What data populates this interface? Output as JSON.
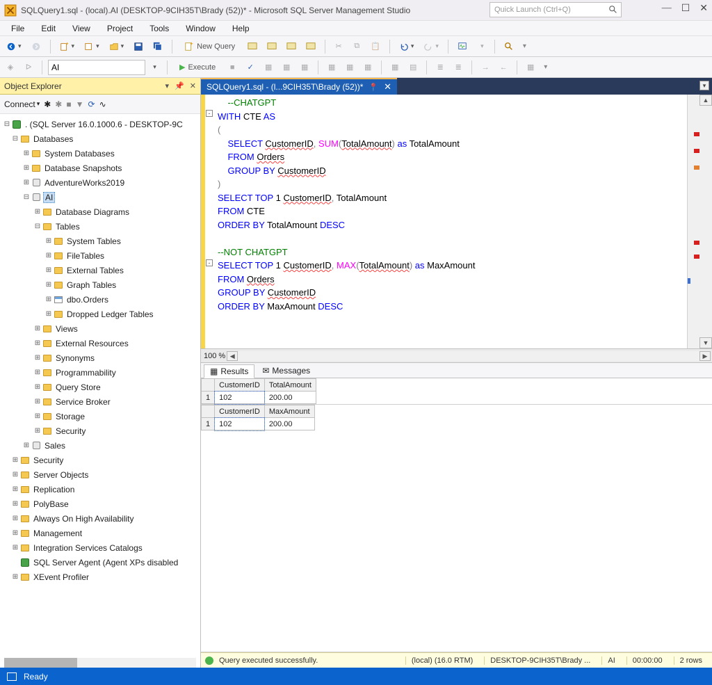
{
  "title_bar": {
    "text": "SQLQuery1.sql - (local).AI (DESKTOP-9CIH35T\\Brady (52))* - Microsoft SQL Server Management Studio",
    "quick_launch_placeholder": "Quick Launch (Ctrl+Q)"
  },
  "menu": {
    "items": [
      "File",
      "Edit",
      "View",
      "Project",
      "Tools",
      "Window",
      "Help"
    ]
  },
  "toolbar1": {
    "new_query": "New Query",
    "db_selector": "AI"
  },
  "toolbar2": {
    "db_selector": "AI",
    "execute": "Execute"
  },
  "object_explorer": {
    "title": "Object Explorer",
    "connect": "Connect",
    "nodes": [
      {
        "depth": 0,
        "tw": "⊟",
        "icon": "srv",
        "label": ". (SQL Server 16.0.1000.6 - DESKTOP-9C"
      },
      {
        "depth": 1,
        "tw": "⊟",
        "icon": "folder",
        "label": "Databases"
      },
      {
        "depth": 2,
        "tw": "⊞",
        "icon": "folder",
        "label": "System Databases"
      },
      {
        "depth": 2,
        "tw": "⊞",
        "icon": "folder",
        "label": "Database Snapshots"
      },
      {
        "depth": 2,
        "tw": "⊞",
        "icon": "db",
        "label": "AdventureWorks2019"
      },
      {
        "depth": 2,
        "tw": "⊟",
        "icon": "db",
        "label": "AI",
        "selected": true
      },
      {
        "depth": 3,
        "tw": "⊞",
        "icon": "folder",
        "label": "Database Diagrams"
      },
      {
        "depth": 3,
        "tw": "⊟",
        "icon": "folder",
        "label": "Tables"
      },
      {
        "depth": 4,
        "tw": "⊞",
        "icon": "folder",
        "label": "System Tables"
      },
      {
        "depth": 4,
        "tw": "⊞",
        "icon": "folder",
        "label": "FileTables"
      },
      {
        "depth": 4,
        "tw": "⊞",
        "icon": "folder",
        "label": "External Tables"
      },
      {
        "depth": 4,
        "tw": "⊞",
        "icon": "folder",
        "label": "Graph Tables"
      },
      {
        "depth": 4,
        "tw": "⊞",
        "icon": "tbl",
        "label": "dbo.Orders"
      },
      {
        "depth": 4,
        "tw": "⊞",
        "icon": "folder",
        "label": "Dropped Ledger Tables"
      },
      {
        "depth": 3,
        "tw": "⊞",
        "icon": "folder",
        "label": "Views"
      },
      {
        "depth": 3,
        "tw": "⊞",
        "icon": "folder",
        "label": "External Resources"
      },
      {
        "depth": 3,
        "tw": "⊞",
        "icon": "folder",
        "label": "Synonyms"
      },
      {
        "depth": 3,
        "tw": "⊞",
        "icon": "folder",
        "label": "Programmability"
      },
      {
        "depth": 3,
        "tw": "⊞",
        "icon": "folder",
        "label": "Query Store"
      },
      {
        "depth": 3,
        "tw": "⊞",
        "icon": "folder",
        "label": "Service Broker"
      },
      {
        "depth": 3,
        "tw": "⊞",
        "icon": "folder",
        "label": "Storage"
      },
      {
        "depth": 3,
        "tw": "⊞",
        "icon": "folder",
        "label": "Security"
      },
      {
        "depth": 2,
        "tw": "⊞",
        "icon": "db",
        "label": "Sales"
      },
      {
        "depth": 1,
        "tw": "⊞",
        "icon": "folder",
        "label": "Security"
      },
      {
        "depth": 1,
        "tw": "⊞",
        "icon": "folder",
        "label": "Server Objects"
      },
      {
        "depth": 1,
        "tw": "⊞",
        "icon": "folder",
        "label": "Replication"
      },
      {
        "depth": 1,
        "tw": "⊞",
        "icon": "folder",
        "label": "PolyBase"
      },
      {
        "depth": 1,
        "tw": "⊞",
        "icon": "folder",
        "label": "Always On High Availability"
      },
      {
        "depth": 1,
        "tw": "⊞",
        "icon": "folder",
        "label": "Management"
      },
      {
        "depth": 1,
        "tw": "⊞",
        "icon": "folder",
        "label": "Integration Services Catalogs"
      },
      {
        "depth": 1,
        "tw": "",
        "icon": "srv",
        "label": "SQL Server Agent (Agent XPs disabled"
      },
      {
        "depth": 1,
        "tw": "⊞",
        "icon": "folder",
        "label": "XEvent Profiler"
      }
    ]
  },
  "editor": {
    "tab_label": "SQLQuery1.sql - (l...9CIH35T\\Brady (52))*",
    "zoom": "100 %",
    "code_lines": [
      [
        {
          "c": "gr",
          "t": "    --CHATGPT"
        }
      ],
      [
        {
          "c": "b",
          "t": "WITH"
        },
        {
          "c": "k",
          "t": " CTE "
        },
        {
          "c": "b",
          "t": "AS"
        }
      ],
      [
        {
          "c": "g",
          "t": "("
        }
      ],
      [
        {
          "c": "k",
          "t": "    "
        },
        {
          "c": "b",
          "t": "SELECT"
        },
        {
          "c": "k",
          "t": " "
        },
        {
          "c": "k",
          "t": "CustomerID",
          "u": 1
        },
        {
          "c": "g",
          "t": ", "
        },
        {
          "c": "m",
          "t": "SUM"
        },
        {
          "c": "g",
          "t": "("
        },
        {
          "c": "k",
          "t": "TotalAmount",
          "u": 1
        },
        {
          "c": "g",
          "t": ")"
        },
        {
          "c": "b",
          "t": " as "
        },
        {
          "c": "k",
          "t": "TotalAmount"
        }
      ],
      [
        {
          "c": "k",
          "t": "    "
        },
        {
          "c": "b",
          "t": "FROM"
        },
        {
          "c": "k",
          "t": " "
        },
        {
          "c": "k",
          "t": "Orders",
          "u": 1
        }
      ],
      [
        {
          "c": "k",
          "t": "    "
        },
        {
          "c": "b",
          "t": "GROUP BY"
        },
        {
          "c": "k",
          "t": " "
        },
        {
          "c": "k",
          "t": "CustomerID",
          "u": 1
        }
      ],
      [
        {
          "c": "g",
          "t": ")"
        }
      ],
      [
        {
          "c": "b",
          "t": "SELECT TOP"
        },
        {
          "c": "k",
          "t": " 1 "
        },
        {
          "c": "k",
          "t": "CustomerID",
          "u": 1
        },
        {
          "c": "g",
          "t": ", "
        },
        {
          "c": "k",
          "t": "TotalAmount"
        }
      ],
      [
        {
          "c": "b",
          "t": "FROM"
        },
        {
          "c": "k",
          "t": " CTE"
        }
      ],
      [
        {
          "c": "b",
          "t": "ORDER BY"
        },
        {
          "c": "k",
          "t": " TotalAmount "
        },
        {
          "c": "b",
          "t": "DESC"
        }
      ],
      [
        {
          "c": "k",
          "t": ""
        }
      ],
      [
        {
          "c": "gr",
          "t": "--NOT CHATGPT"
        }
      ],
      [
        {
          "c": "b",
          "t": "SELECT TOP"
        },
        {
          "c": "k",
          "t": " 1 "
        },
        {
          "c": "k",
          "t": "CustomerID",
          "u": 1
        },
        {
          "c": "g",
          "t": ", "
        },
        {
          "c": "m",
          "t": "MAX"
        },
        {
          "c": "g",
          "t": "("
        },
        {
          "c": "k",
          "t": "TotalAmount",
          "u": 1
        },
        {
          "c": "g",
          "t": ")"
        },
        {
          "c": "b",
          "t": " as "
        },
        {
          "c": "k",
          "t": "MaxAmount"
        }
      ],
      [
        {
          "c": "b",
          "t": "FROM"
        },
        {
          "c": "k",
          "t": " "
        },
        {
          "c": "k",
          "t": "Orders",
          "u": 1
        }
      ],
      [
        {
          "c": "b",
          "t": "GROUP BY"
        },
        {
          "c": "k",
          "t": " "
        },
        {
          "c": "k",
          "t": "CustomerID",
          "u": 1
        }
      ],
      [
        {
          "c": "b",
          "t": "ORDER BY"
        },
        {
          "c": "k",
          "t": " MaxAmount "
        },
        {
          "c": "b",
          "t": "DESC"
        }
      ]
    ]
  },
  "results": {
    "tab_results": "Results",
    "tab_messages": "Messages",
    "grids": [
      {
        "headers": [
          "",
          "CustomerID",
          "TotalAmount"
        ],
        "rows": [
          [
            "1",
            "102",
            "200.00"
          ]
        ]
      },
      {
        "headers": [
          "",
          "CustomerID",
          "MaxAmount"
        ],
        "rows": [
          [
            "1",
            "102",
            "200.00"
          ]
        ]
      }
    ]
  },
  "status_exec": {
    "msg": "Query executed successfully.",
    "server": "(local) (16.0 RTM)",
    "user": "DESKTOP-9CIH35T\\Brady ...",
    "db": "AI",
    "elapsed": "00:00:00",
    "rows": "2 rows"
  },
  "app_status": {
    "text": "Ready"
  }
}
